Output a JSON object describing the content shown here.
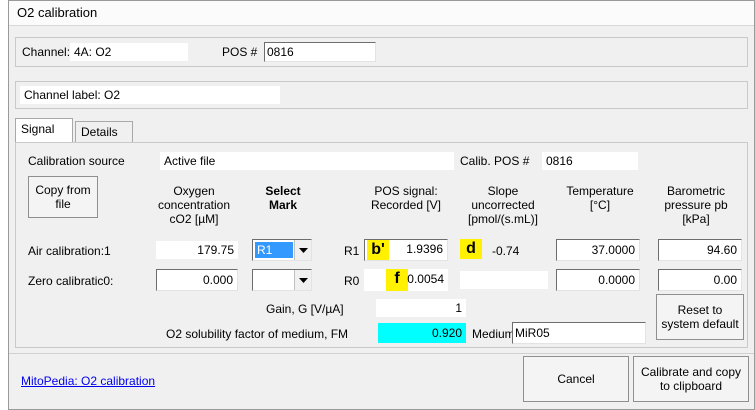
{
  "window": {
    "title": "O2 calibration"
  },
  "channel": {
    "label": "Channel:",
    "value": "4A: O2",
    "pos_label": "POS #",
    "pos_value": "0816"
  },
  "channel_label": {
    "text": "Channel label: O2"
  },
  "tabs": [
    {
      "label": "Signal"
    },
    {
      "label": "Details"
    }
  ],
  "source": {
    "label": "Calibration source",
    "value": "Active file",
    "calib_pos_label": "Calib. POS #",
    "calib_pos_value": "0816"
  },
  "buttons": {
    "copy_from_file": "Copy from file",
    "reset": "Reset to system default",
    "cancel": "Cancel",
    "calibrate": "Calibrate and copy to clipboard"
  },
  "headers": {
    "oxygen": "Oxygen concentration cO2 [µM]",
    "select_mark": "Select Mark",
    "pos_signal": "POS signal: Recorded [V]",
    "slope": "Slope uncorrected [pmol/(s.mL)]",
    "temperature": "Temperature [°C]",
    "pressure": "Barometric pressure pb [kPa]"
  },
  "air": {
    "label": "Air calibration:1",
    "oxygen": "179.75",
    "mark": "R1",
    "r_label": "R1",
    "signal": "1.9396",
    "slope": "-0.74",
    "temperature": "37.0000",
    "pressure": "94.60"
  },
  "zero": {
    "label": "Zero calibratic0:",
    "oxygen": "0.000",
    "mark": "",
    "r_label": "R0",
    "signal": "0.0054",
    "slope": "",
    "temperature": "0.0000",
    "pressure": "0.00"
  },
  "gain": {
    "label": "Gain, G [V/µA]",
    "value": "1"
  },
  "solubility": {
    "label": "O2 solubility factor of medium, FM",
    "value": "0.920",
    "medium_label": "Medium",
    "medium_value": "MiR05"
  },
  "annotations": {
    "b": "b'",
    "d": "d",
    "f": "f"
  },
  "link": {
    "text": "MitoPedia: O2 calibration"
  },
  "colors": {
    "highlight": "#00ffff",
    "annotation": "#fff100",
    "select": "#3399ff"
  }
}
